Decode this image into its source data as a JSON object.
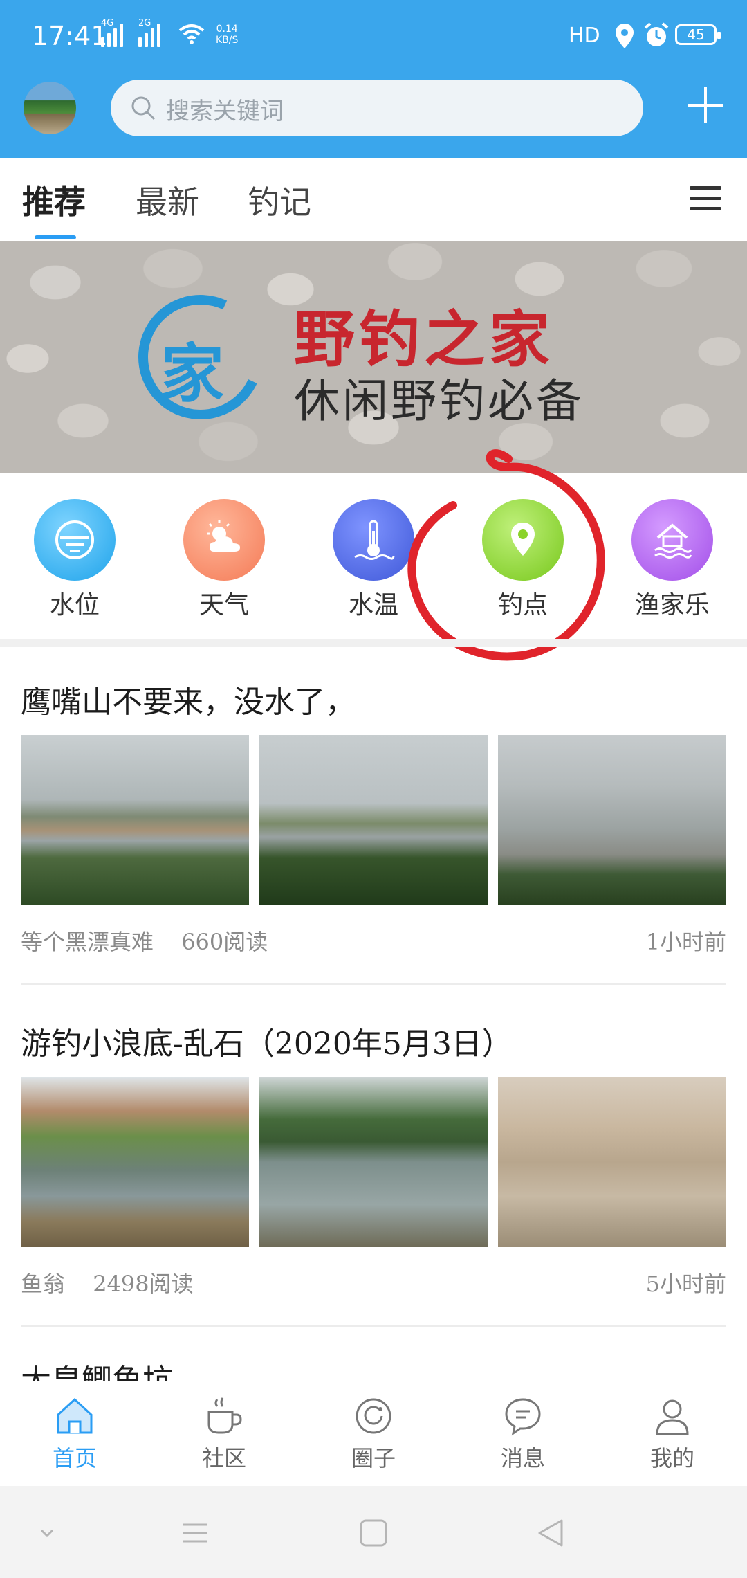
{
  "status_bar": {
    "time": "17:41",
    "net1": "4G",
    "net2": "2G",
    "speed_value": "0.14",
    "speed_unit": "KB/S",
    "hd": "HD",
    "battery": "45"
  },
  "header": {
    "search_placeholder": "搜索关键词"
  },
  "tabs": [
    {
      "label": "推荐",
      "active": true
    },
    {
      "label": "最新",
      "active": false
    },
    {
      "label": "钓记",
      "active": false
    }
  ],
  "banner": {
    "logo_char": "家",
    "title": "野钓之家",
    "subtitle": "休闲野钓必备"
  },
  "shortcuts": [
    {
      "label": "水位",
      "icon": "water-level-icon",
      "color": "#1ea3ea"
    },
    {
      "label": "天气",
      "icon": "weather-icon",
      "color": "#f47a56"
    },
    {
      "label": "水温",
      "icon": "thermometer-icon",
      "color": "#3f58d8"
    },
    {
      "label": "钓点",
      "icon": "location-pin-icon",
      "color": "#78c81c"
    },
    {
      "label": "渔家乐",
      "icon": "fishing-house-icon",
      "color": "#a24ee8"
    }
  ],
  "posts": [
    {
      "title": "鹰嘴山不要来，没水了，",
      "author": "等个黑漂真难",
      "reads": "660阅读",
      "time": "1小时前"
    },
    {
      "title": "游钓小浪底-乱石（2020年5月3日）",
      "author": "鱼翁",
      "reads": "2498阅读",
      "time": "5小时前"
    }
  ],
  "next_post_title": "大皇鲫鱼坑",
  "bottom_nav": [
    {
      "label": "首页",
      "icon": "home-icon",
      "active": true
    },
    {
      "label": "社区",
      "icon": "coffee-cup-icon",
      "active": false
    },
    {
      "label": "圈子",
      "icon": "circle-icon",
      "active": false
    },
    {
      "label": "消息",
      "icon": "message-icon",
      "active": false
    },
    {
      "label": "我的",
      "icon": "user-icon",
      "active": false
    }
  ],
  "colors": {
    "header_blue": "#3aa6ec",
    "accent": "#2a9df4",
    "annotation_red": "#e0242b"
  }
}
